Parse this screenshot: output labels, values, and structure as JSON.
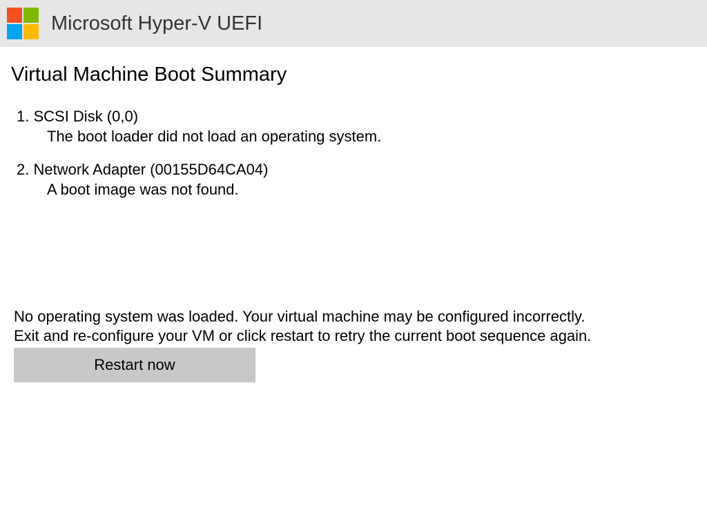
{
  "header": {
    "title": "Microsoft Hyper-V UEFI"
  },
  "page_title": "Virtual Machine Boot Summary",
  "boot_entries": [
    {
      "header": "1. SCSI Disk   (0,0)",
      "detail": "The boot loader did not load an operating system."
    },
    {
      "header": "2. Network Adapter (00155D64CA04)",
      "detail": "A boot image was not found."
    }
  ],
  "error_message_line1": "No operating system was loaded. Your virtual machine may be configured incorrectly.",
  "error_message_line2": "Exit and re-configure your VM or click restart to retry the current boot sequence again.",
  "restart_button_label": "Restart now"
}
